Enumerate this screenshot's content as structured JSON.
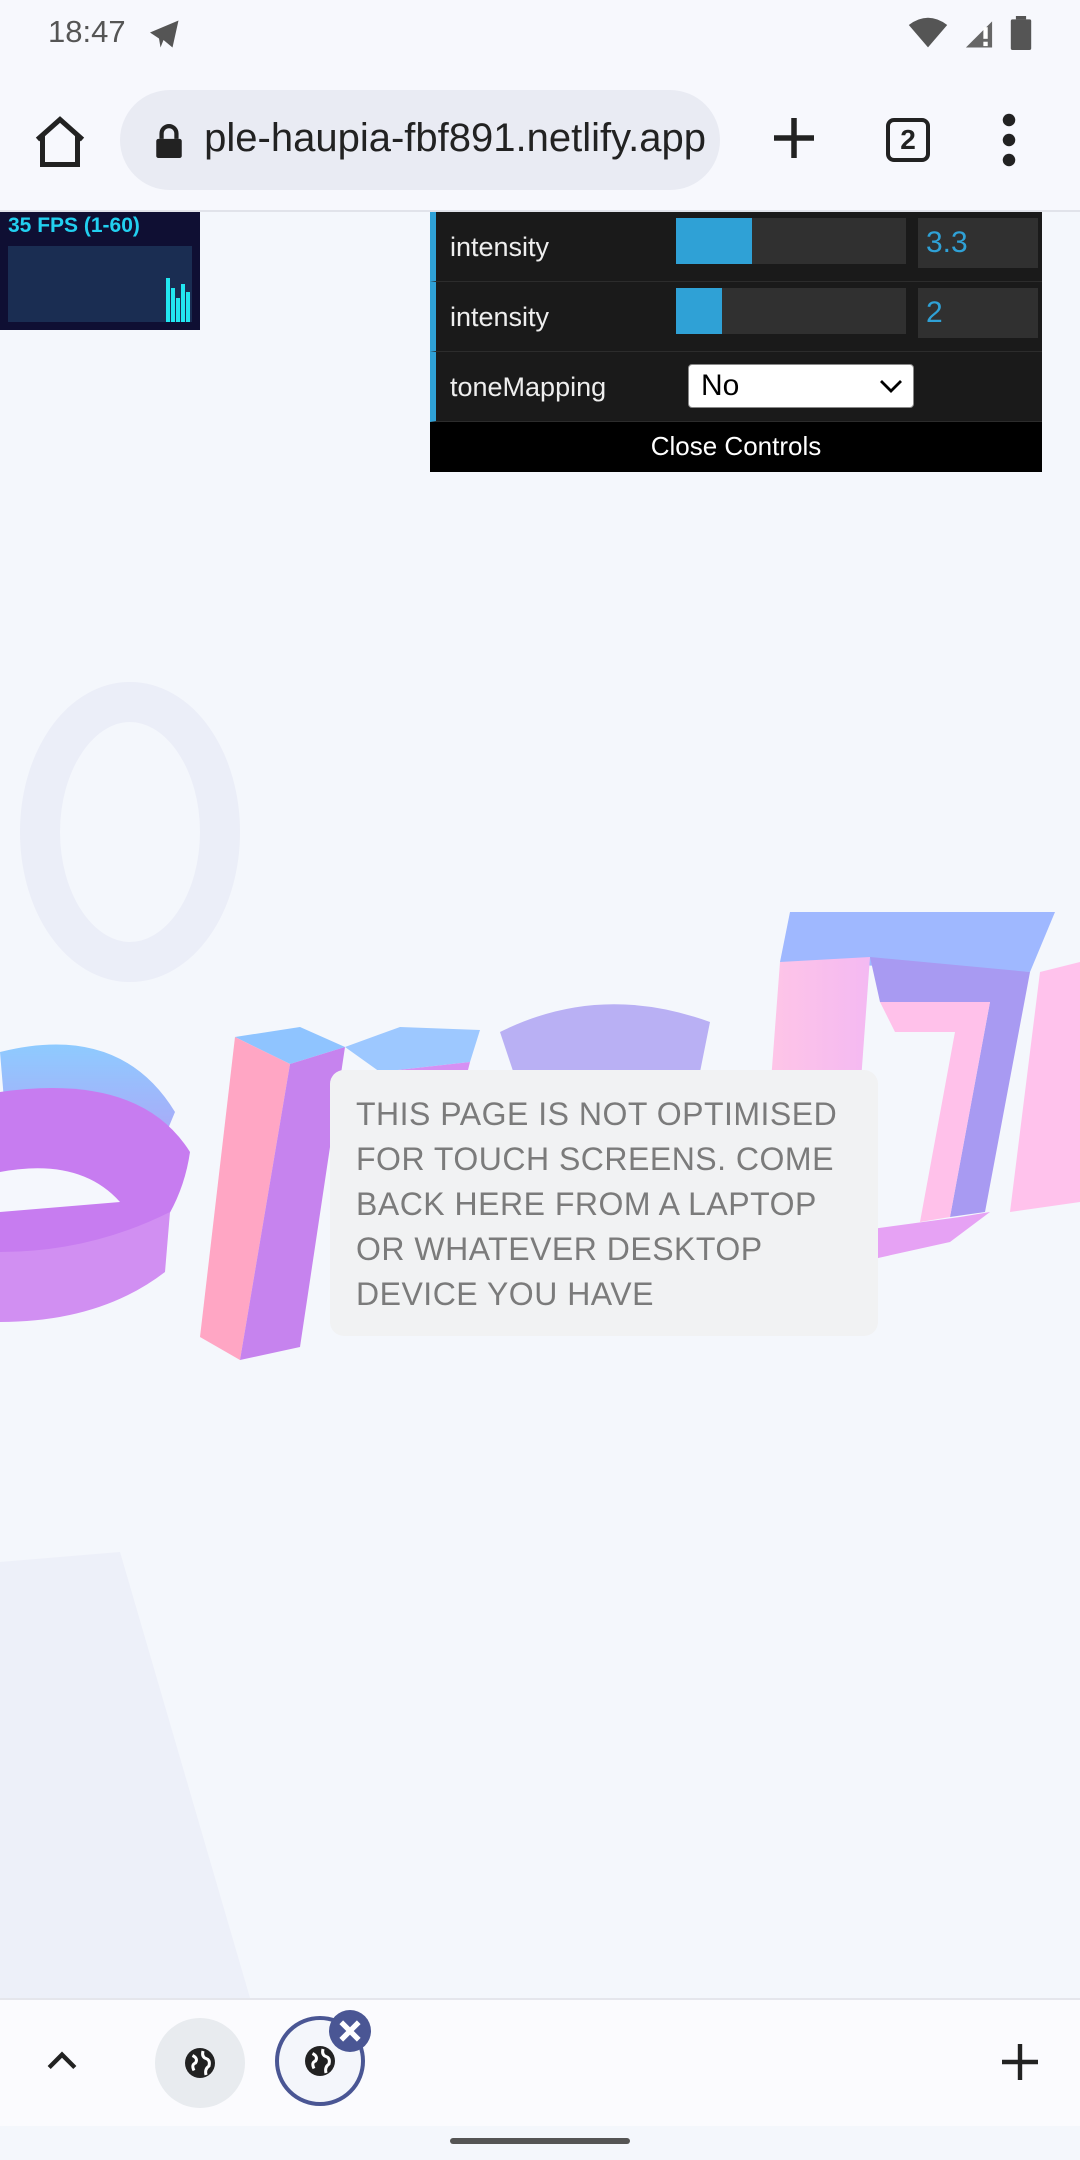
{
  "status_bar": {
    "time": "18:47"
  },
  "browser": {
    "url": "ple-haupia-fbf891.netlify.app",
    "tab_count": "2"
  },
  "fps_panel": {
    "label": "35 FPS (1-60)"
  },
  "controls": {
    "rows": [
      {
        "label": "intensity",
        "value": "3.3",
        "fill": 0.33
      },
      {
        "label": "intensity",
        "value": "2",
        "fill": 0.2
      }
    ],
    "tone_mapping": {
      "label": "toneMapping",
      "selected": "No"
    },
    "close_label": "Close Controls"
  },
  "notice": {
    "text": "THIS PAGE IS NOT OPTIMISED FOR TOUCH SCREENS. COME BACK HERE FROM A LAPTOP OR WHATEVER DESKTOP DEVICE YOU HAVE"
  },
  "colors": {
    "gui_accent": "#2fa1d6",
    "tab_accent": "#4a5694",
    "text_pink": "#d184f0",
    "text_blue": "#8cc0ff"
  }
}
